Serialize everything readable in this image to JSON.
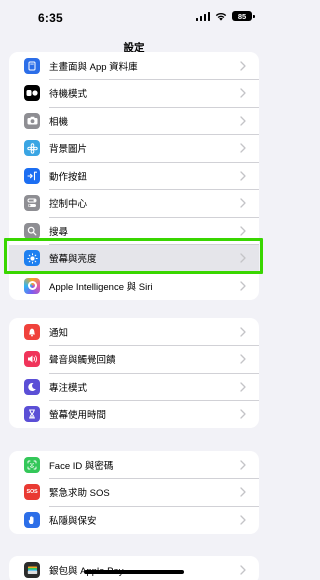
{
  "status": {
    "time": "6:35",
    "battery": "85"
  },
  "nav": {
    "title": "設定"
  },
  "groups": [
    {
      "rows": [
        {
          "label": "主畫面與 App 資料庫",
          "icon": "home-screen-icon",
          "color": "#2c6ee8"
        },
        {
          "label": "待機模式",
          "icon": "standby-icon",
          "color": "#000000"
        },
        {
          "label": "相機",
          "icon": "camera-icon",
          "color": "#8e8e93"
        },
        {
          "label": "背景圖片",
          "icon": "wallpaper-icon",
          "color": "#3aa5e3"
        },
        {
          "label": "動作按鈕",
          "icon": "action-button-icon",
          "color": "#1c6ef2"
        },
        {
          "label": "控制中心",
          "icon": "control-center-icon",
          "color": "#8e8e93"
        },
        {
          "label": "搜尋",
          "icon": "search-icon",
          "color": "#8e8e93"
        },
        {
          "label": "螢幕與亮度",
          "icon": "brightness-icon",
          "color": "#1e80f0"
        },
        {
          "label": "Apple Intelligence 與 Siri",
          "icon": "siri-icon",
          "color": "#e05aa8"
        }
      ]
    },
    {
      "rows": [
        {
          "label": "通知",
          "icon": "notifications-icon",
          "color": "#f0423c"
        },
        {
          "label": "聲音與觸覺回饋",
          "icon": "sounds-icon",
          "color": "#f0345a"
        },
        {
          "label": "專注模式",
          "icon": "focus-icon",
          "color": "#5b4fd6"
        },
        {
          "label": "螢幕使用時間",
          "icon": "screen-time-icon",
          "color": "#5b4fd6"
        }
      ]
    },
    {
      "rows": [
        {
          "label": "Face ID 與密碼",
          "icon": "face-id-icon",
          "color": "#34c759"
        },
        {
          "label": "緊急求助 SOS",
          "icon": "sos-icon",
          "color": "#e93a33"
        },
        {
          "label": "私隱與保安",
          "icon": "privacy-icon",
          "color": "#2c6ee8"
        }
      ]
    },
    {
      "rows": [
        {
          "label": "銀包與 Apple Pay",
          "icon": "wallet-icon",
          "color": "#2b2b2b"
        }
      ]
    }
  ],
  "highlight_color": "#39d600",
  "sos_text": "SOS"
}
